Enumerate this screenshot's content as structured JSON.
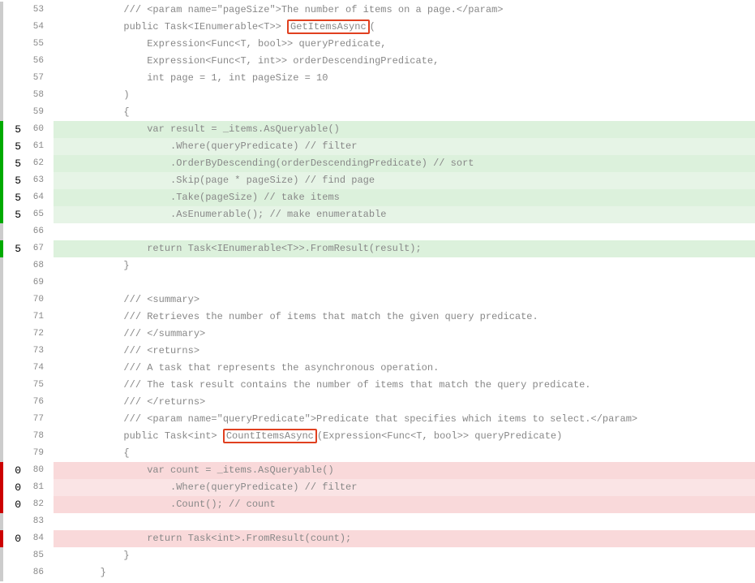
{
  "indent": "            ",
  "lines": [
    {
      "n": 53,
      "mark": "grey",
      "hit": "",
      "hl": "",
      "text": "/// <param name=\"pageSize\">The number of items on a page.</param>"
    },
    {
      "n": 54,
      "mark": "grey",
      "hit": "",
      "hl": "",
      "pre": "public Task<IEnumerable<T>> ",
      "box": "GetItemsAsync",
      "post": "("
    },
    {
      "n": 55,
      "mark": "grey",
      "hit": "",
      "hl": "",
      "text": "    Expression<Func<T, bool>> queryPredicate,"
    },
    {
      "n": 56,
      "mark": "grey",
      "hit": "",
      "hl": "",
      "text": "    Expression<Func<T, int>> orderDescendingPredicate,"
    },
    {
      "n": 57,
      "mark": "grey",
      "hit": "",
      "hl": "",
      "text": "    int page = 1, int pageSize = 10"
    },
    {
      "n": 58,
      "mark": "grey",
      "hit": "",
      "hl": "",
      "text": ")"
    },
    {
      "n": 59,
      "mark": "grey",
      "hit": "",
      "hl": "",
      "text": "{"
    },
    {
      "n": 60,
      "mark": "green",
      "hit": "5",
      "hl": "g1",
      "text": "    var result = _items.AsQueryable()"
    },
    {
      "n": 61,
      "mark": "green",
      "hit": "5",
      "hl": "g2",
      "text": "        .Where(queryPredicate) // filter"
    },
    {
      "n": 62,
      "mark": "green",
      "hit": "5",
      "hl": "g1",
      "text": "        .OrderByDescending(orderDescendingPredicate) // sort"
    },
    {
      "n": 63,
      "mark": "green",
      "hit": "5",
      "hl": "g2",
      "text": "        .Skip(page * pageSize) // find page"
    },
    {
      "n": 64,
      "mark": "green",
      "hit": "5",
      "hl": "g1",
      "text": "        .Take(pageSize) // take items"
    },
    {
      "n": 65,
      "mark": "green",
      "hit": "5",
      "hl": "g2",
      "text": "        .AsEnumerable(); // make enumeratable"
    },
    {
      "n": 66,
      "mark": "grey",
      "hit": "",
      "hl": "",
      "text": ""
    },
    {
      "n": 67,
      "mark": "green",
      "hit": "5",
      "hl": "g1",
      "text": "    return Task<IEnumerable<T>>.FromResult(result);"
    },
    {
      "n": 68,
      "mark": "grey",
      "hit": "",
      "hl": "",
      "text": "}"
    },
    {
      "n": 69,
      "mark": "grey",
      "hit": "",
      "hl": "",
      "text": "",
      "noindent": true
    },
    {
      "n": 70,
      "mark": "grey",
      "hit": "",
      "hl": "",
      "text": "/// <summary>"
    },
    {
      "n": 71,
      "mark": "grey",
      "hit": "",
      "hl": "",
      "text": "/// Retrieves the number of items that match the given query predicate."
    },
    {
      "n": 72,
      "mark": "grey",
      "hit": "",
      "hl": "",
      "text": "/// </summary>"
    },
    {
      "n": 73,
      "mark": "grey",
      "hit": "",
      "hl": "",
      "text": "/// <returns>"
    },
    {
      "n": 74,
      "mark": "grey",
      "hit": "",
      "hl": "",
      "text": "/// A task that represents the asynchronous operation."
    },
    {
      "n": 75,
      "mark": "grey",
      "hit": "",
      "hl": "",
      "text": "/// The task result contains the number of items that match the query predicate."
    },
    {
      "n": 76,
      "mark": "grey",
      "hit": "",
      "hl": "",
      "text": "/// </returns>"
    },
    {
      "n": 77,
      "mark": "grey",
      "hit": "",
      "hl": "",
      "text": "/// <param name=\"queryPredicate\">Predicate that specifies which items to select.</param>"
    },
    {
      "n": 78,
      "mark": "grey",
      "hit": "",
      "hl": "",
      "pre": "public Task<int> ",
      "box": "CountItemsAsync",
      "post": "(Expression<Func<T, bool>> queryPredicate)"
    },
    {
      "n": 79,
      "mark": "grey",
      "hit": "",
      "hl": "",
      "text": "{"
    },
    {
      "n": 80,
      "mark": "red",
      "hit": "0",
      "hl": "p1",
      "text": "    var count = _items.AsQueryable()"
    },
    {
      "n": 81,
      "mark": "red",
      "hit": "0",
      "hl": "p2",
      "text": "        .Where(queryPredicate) // filter"
    },
    {
      "n": 82,
      "mark": "red",
      "hit": "0",
      "hl": "p1",
      "text": "        .Count(); // count"
    },
    {
      "n": 83,
      "mark": "grey",
      "hit": "",
      "hl": "",
      "text": ""
    },
    {
      "n": 84,
      "mark": "red",
      "hit": "0",
      "hl": "p1",
      "text": "    return Task<int>.FromResult(count);"
    },
    {
      "n": 85,
      "mark": "grey",
      "hit": "",
      "hl": "",
      "text": "}"
    },
    {
      "n": 86,
      "mark": "grey",
      "hit": "",
      "hl": "",
      "raw": "        }"
    }
  ]
}
